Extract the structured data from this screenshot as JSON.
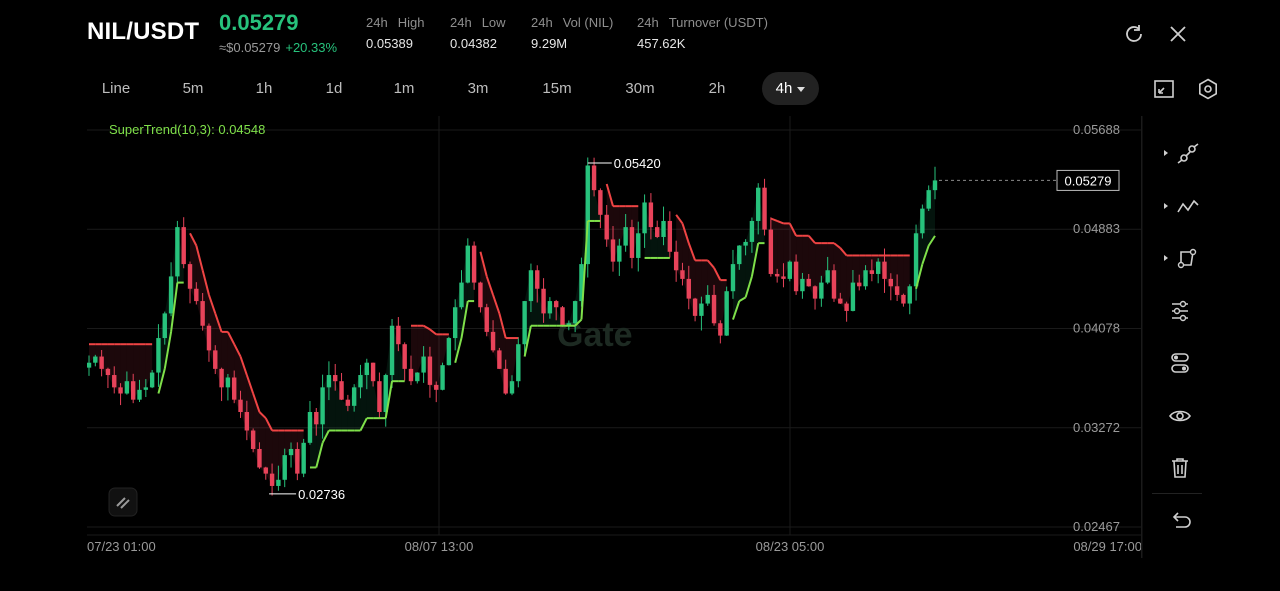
{
  "header": {
    "pair": "NIL/USDT",
    "price": "0.05279",
    "price_usd": "≈$0.05279",
    "change": "+20.33%",
    "stats": [
      {
        "label1": "24h",
        "label2": "High",
        "value": "0.05389"
      },
      {
        "label1": "24h",
        "label2": "Low",
        "value": "0.04382"
      },
      {
        "label1": "24h",
        "label2": "Vol (NIL)",
        "value": "9.29M"
      },
      {
        "label1": "24h",
        "label2": "Turnover (USDT)",
        "value": "457.62K"
      }
    ]
  },
  "timeframes": [
    "Line",
    "5m",
    "1h",
    "1d",
    "1m",
    "3m",
    "15m",
    "30m",
    "2h",
    "4h"
  ],
  "selected_timeframe": "4h",
  "indicator": {
    "label": "SuperTrend(10,3): 0.04548",
    "color": "#7fe04a"
  },
  "watermark": "Gate",
  "chart_data": {
    "type": "candlestick",
    "y_ticks": [
      "0.05688",
      "0.04883",
      "0.04078",
      "0.03272",
      "0.02467"
    ],
    "ylim": [
      0.02467,
      0.05688
    ],
    "x_ticks": [
      "07/23 01:00",
      "08/07 13:00",
      "08/23 05:00",
      "08/29 17:00"
    ],
    "last_price_label": "0.05279",
    "last_price": 0.05279,
    "high_marker": "0.05420",
    "high_value": 0.0542,
    "low_marker": "0.02736",
    "low_value": 0.02736,
    "colors": {
      "up": "#27c27c",
      "down": "#e8435a",
      "trend_up": "#7fe04a",
      "trend_down": "#ef4444"
    },
    "series": [
      {
        "name": "close",
        "values": [
          0.038,
          0.0385,
          0.0375,
          0.037,
          0.036,
          0.0355,
          0.0365,
          0.035,
          0.0358,
          0.036,
          0.0372,
          0.04,
          0.042,
          0.045,
          0.049,
          0.046,
          0.044,
          0.043,
          0.041,
          0.039,
          0.0375,
          0.036,
          0.0368,
          0.035,
          0.034,
          0.0325,
          0.031,
          0.0295,
          0.029,
          0.028,
          0.0285,
          0.0305,
          0.031,
          0.029,
          0.0315,
          0.034,
          0.033,
          0.036,
          0.037,
          0.0365,
          0.035,
          0.0345,
          0.036,
          0.037,
          0.038,
          0.0365,
          0.034,
          0.037,
          0.041,
          0.0395,
          0.0375,
          0.0365,
          0.0372,
          0.0385,
          0.0362,
          0.0358,
          0.0378,
          0.04,
          0.0425,
          0.0445,
          0.0475,
          0.0445,
          0.0425,
          0.0405,
          0.039,
          0.0375,
          0.0355,
          0.0365,
          0.0395,
          0.043,
          0.0455,
          0.044,
          0.042,
          0.043,
          0.0425,
          0.041,
          0.0412,
          0.043,
          0.046,
          0.054,
          0.052,
          0.05,
          0.048,
          0.0462,
          0.0475,
          0.049,
          0.0465,
          0.0485,
          0.051,
          0.049,
          0.0482,
          0.0495,
          0.047,
          0.0455,
          0.0448,
          0.0432,
          0.0418,
          0.0428,
          0.0435,
          0.0412,
          0.0402,
          0.0438,
          0.046,
          0.0475,
          0.0478,
          0.0495,
          0.0522,
          0.0488,
          0.0452,
          0.045,
          0.0448,
          0.0462,
          0.0438,
          0.0448,
          0.0442,
          0.0432,
          0.0445,
          0.0455,
          0.0432,
          0.0428,
          0.0422,
          0.0445,
          0.0442,
          0.0455,
          0.0452,
          0.0462,
          0.0448,
          0.0442,
          0.0435,
          0.0428,
          0.0442,
          0.0485,
          0.0505,
          0.052,
          0.05279
        ]
      }
    ]
  },
  "toolbar_right": [
    "trend-line-tool-icon",
    "pattern-tool-icon",
    "shape-tool-icon",
    "indicator-settings-icon",
    "layers-icon",
    "visibility-icon",
    "delete-icon",
    "undo-icon"
  ]
}
